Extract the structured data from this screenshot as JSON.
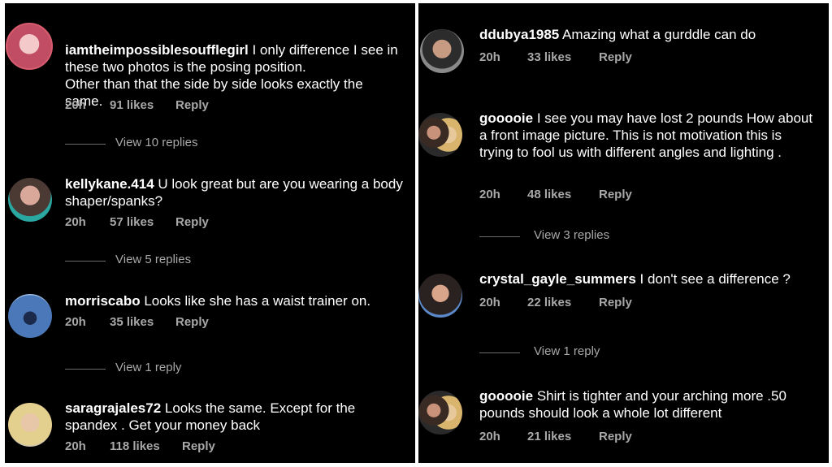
{
  "left": {
    "comments": [
      {
        "username": "iamtheimpossiblesoufflegirl",
        "text": " I only difference I see in these two photos is the posing position.\nOther than that the side by side looks exactly the same.",
        "time": "20h",
        "likes": "91 likes",
        "reply": "Reply",
        "view_replies": "View 10 replies"
      },
      {
        "username": "kellykane.414",
        "text": " U look great but are you wearing a body shaper/spanks?",
        "time": "20h",
        "likes": "57 likes",
        "reply": "Reply",
        "view_replies": "View 5 replies"
      },
      {
        "username": "morriscabo",
        "text": " Looks like she has a waist trainer on.",
        "time": "20h",
        "likes": "35 likes",
        "reply": "Reply",
        "view_replies": "View 1 reply"
      },
      {
        "username": "saragrajales72",
        "text": " Looks the same. Except for the spandex . Get your money back",
        "time": "20h",
        "likes": "118 likes",
        "reply": "Reply"
      }
    ]
  },
  "right": {
    "comments": [
      {
        "username": "ddubya1985",
        "text": " Amazing what a gurddle can do",
        "time": "20h",
        "likes": "33 likes",
        "reply": "Reply"
      },
      {
        "username": "gooooie",
        "text": " I see you may have lost 2 pounds How about a front image picture. This is not motivation this is trying to fool us with different  angles and lighting .",
        "time": "20h",
        "likes": "48 likes",
        "reply": "Reply",
        "view_replies": "View 3 replies"
      },
      {
        "username": "crystal_gayle_summers",
        "text": " I don't see a difference ?",
        "time": "20h",
        "likes": "22 likes",
        "reply": "Reply",
        "view_replies": "View 1 reply"
      },
      {
        "username": "gooooie",
        "text": " Shirt is tighter and your arching more .50 pounds should look a whole lot different",
        "time": "20h",
        "likes": "21 likes",
        "reply": "Reply"
      }
    ]
  }
}
